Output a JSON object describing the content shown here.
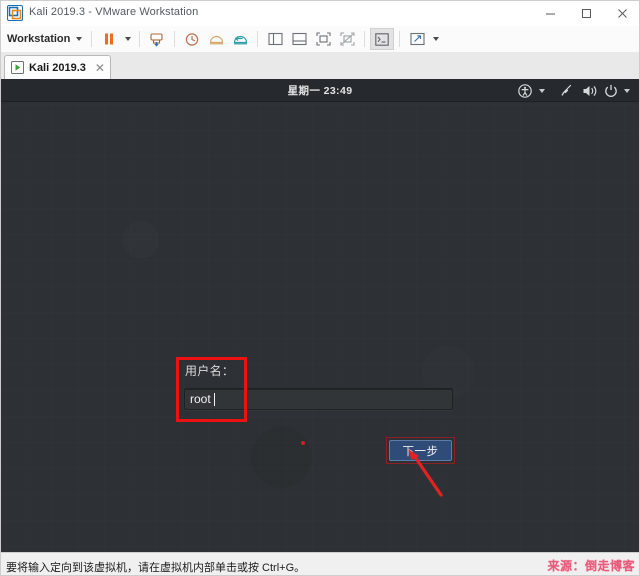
{
  "window": {
    "title": "Kali 2019.3 - VMware Workstation",
    "app_icon": "vmware-vm-icon",
    "controls": {
      "minimize": "—",
      "maximize": "☐",
      "close": "✕",
      "minimize_name": "minimize-icon",
      "maximize_name": "maximize-icon",
      "close_name": "close-icon"
    }
  },
  "toolbar": {
    "menu_label": "Workstation",
    "items": [
      {
        "name": "suspend-icon",
        "title": "Suspend"
      },
      {
        "name": "suspend-dropdown-caret-icon",
        "title": "Suspend options"
      },
      {
        "name": "send-ctrl-alt-del-icon",
        "title": "Send Ctrl+Alt+Del"
      },
      {
        "name": "snapshot-manager-icon",
        "title": "Manage Snapshots"
      },
      {
        "name": "take-snapshot-icon",
        "title": "Take Snapshot"
      },
      {
        "name": "revert-snapshot-icon",
        "title": "Revert to Snapshot"
      },
      {
        "name": "show-sidebar-icon",
        "title": "Show library"
      },
      {
        "name": "show-thumbnails-icon",
        "title": "Show thumbnail bar"
      },
      {
        "name": "full-screen-icon",
        "title": "Enter full screen"
      },
      {
        "name": "unity-mode-icon",
        "title": "Unity mode"
      },
      {
        "name": "console-view-icon",
        "title": "Console view"
      },
      {
        "name": "stretch-guest-icon",
        "title": "Stretch guest"
      },
      {
        "name": "stretch-dropdown-caret-icon",
        "title": "Stretch options"
      }
    ]
  },
  "tab": {
    "label": "Kali 2019.3",
    "icon": "vm-running-icon",
    "close_glyph": "✕"
  },
  "guest": {
    "panel": {
      "clock": "星期一 23:49",
      "tray": [
        {
          "name": "accessibility-icon"
        },
        {
          "name": "accessibility-dropdown-caret-icon"
        },
        {
          "name": "screen-brightness-icon"
        },
        {
          "name": "volume-icon"
        },
        {
          "name": "power-icon"
        },
        {
          "name": "power-dropdown-caret-icon"
        }
      ]
    },
    "login": {
      "username_label": "用户名：",
      "username_value": "root",
      "username_placeholder": "",
      "next_button_label": "下一步"
    },
    "annotations": {
      "highlight_box": "username-field-highlight",
      "button_box": "next-button-highlight",
      "arrow": "pointer-arrow-to-next-button",
      "dot": "cursor-dot",
      "color": "#ee1111"
    }
  },
  "statusbar": {
    "hint": "要将输入定向到该虚拟机，请在虚拟机内部单击或按 Ctrl+G。",
    "watermark": "来源：倒走博客"
  },
  "colors": {
    "desktop_bg": "#2d3034",
    "panel_bg": "#262a2e",
    "button_bg": "#2f4b78",
    "button_border": "#5f7ba8",
    "annotation_red": "#ee1111",
    "chrome_bg": "#f0f0f0",
    "watermark": "#e8476a"
  }
}
